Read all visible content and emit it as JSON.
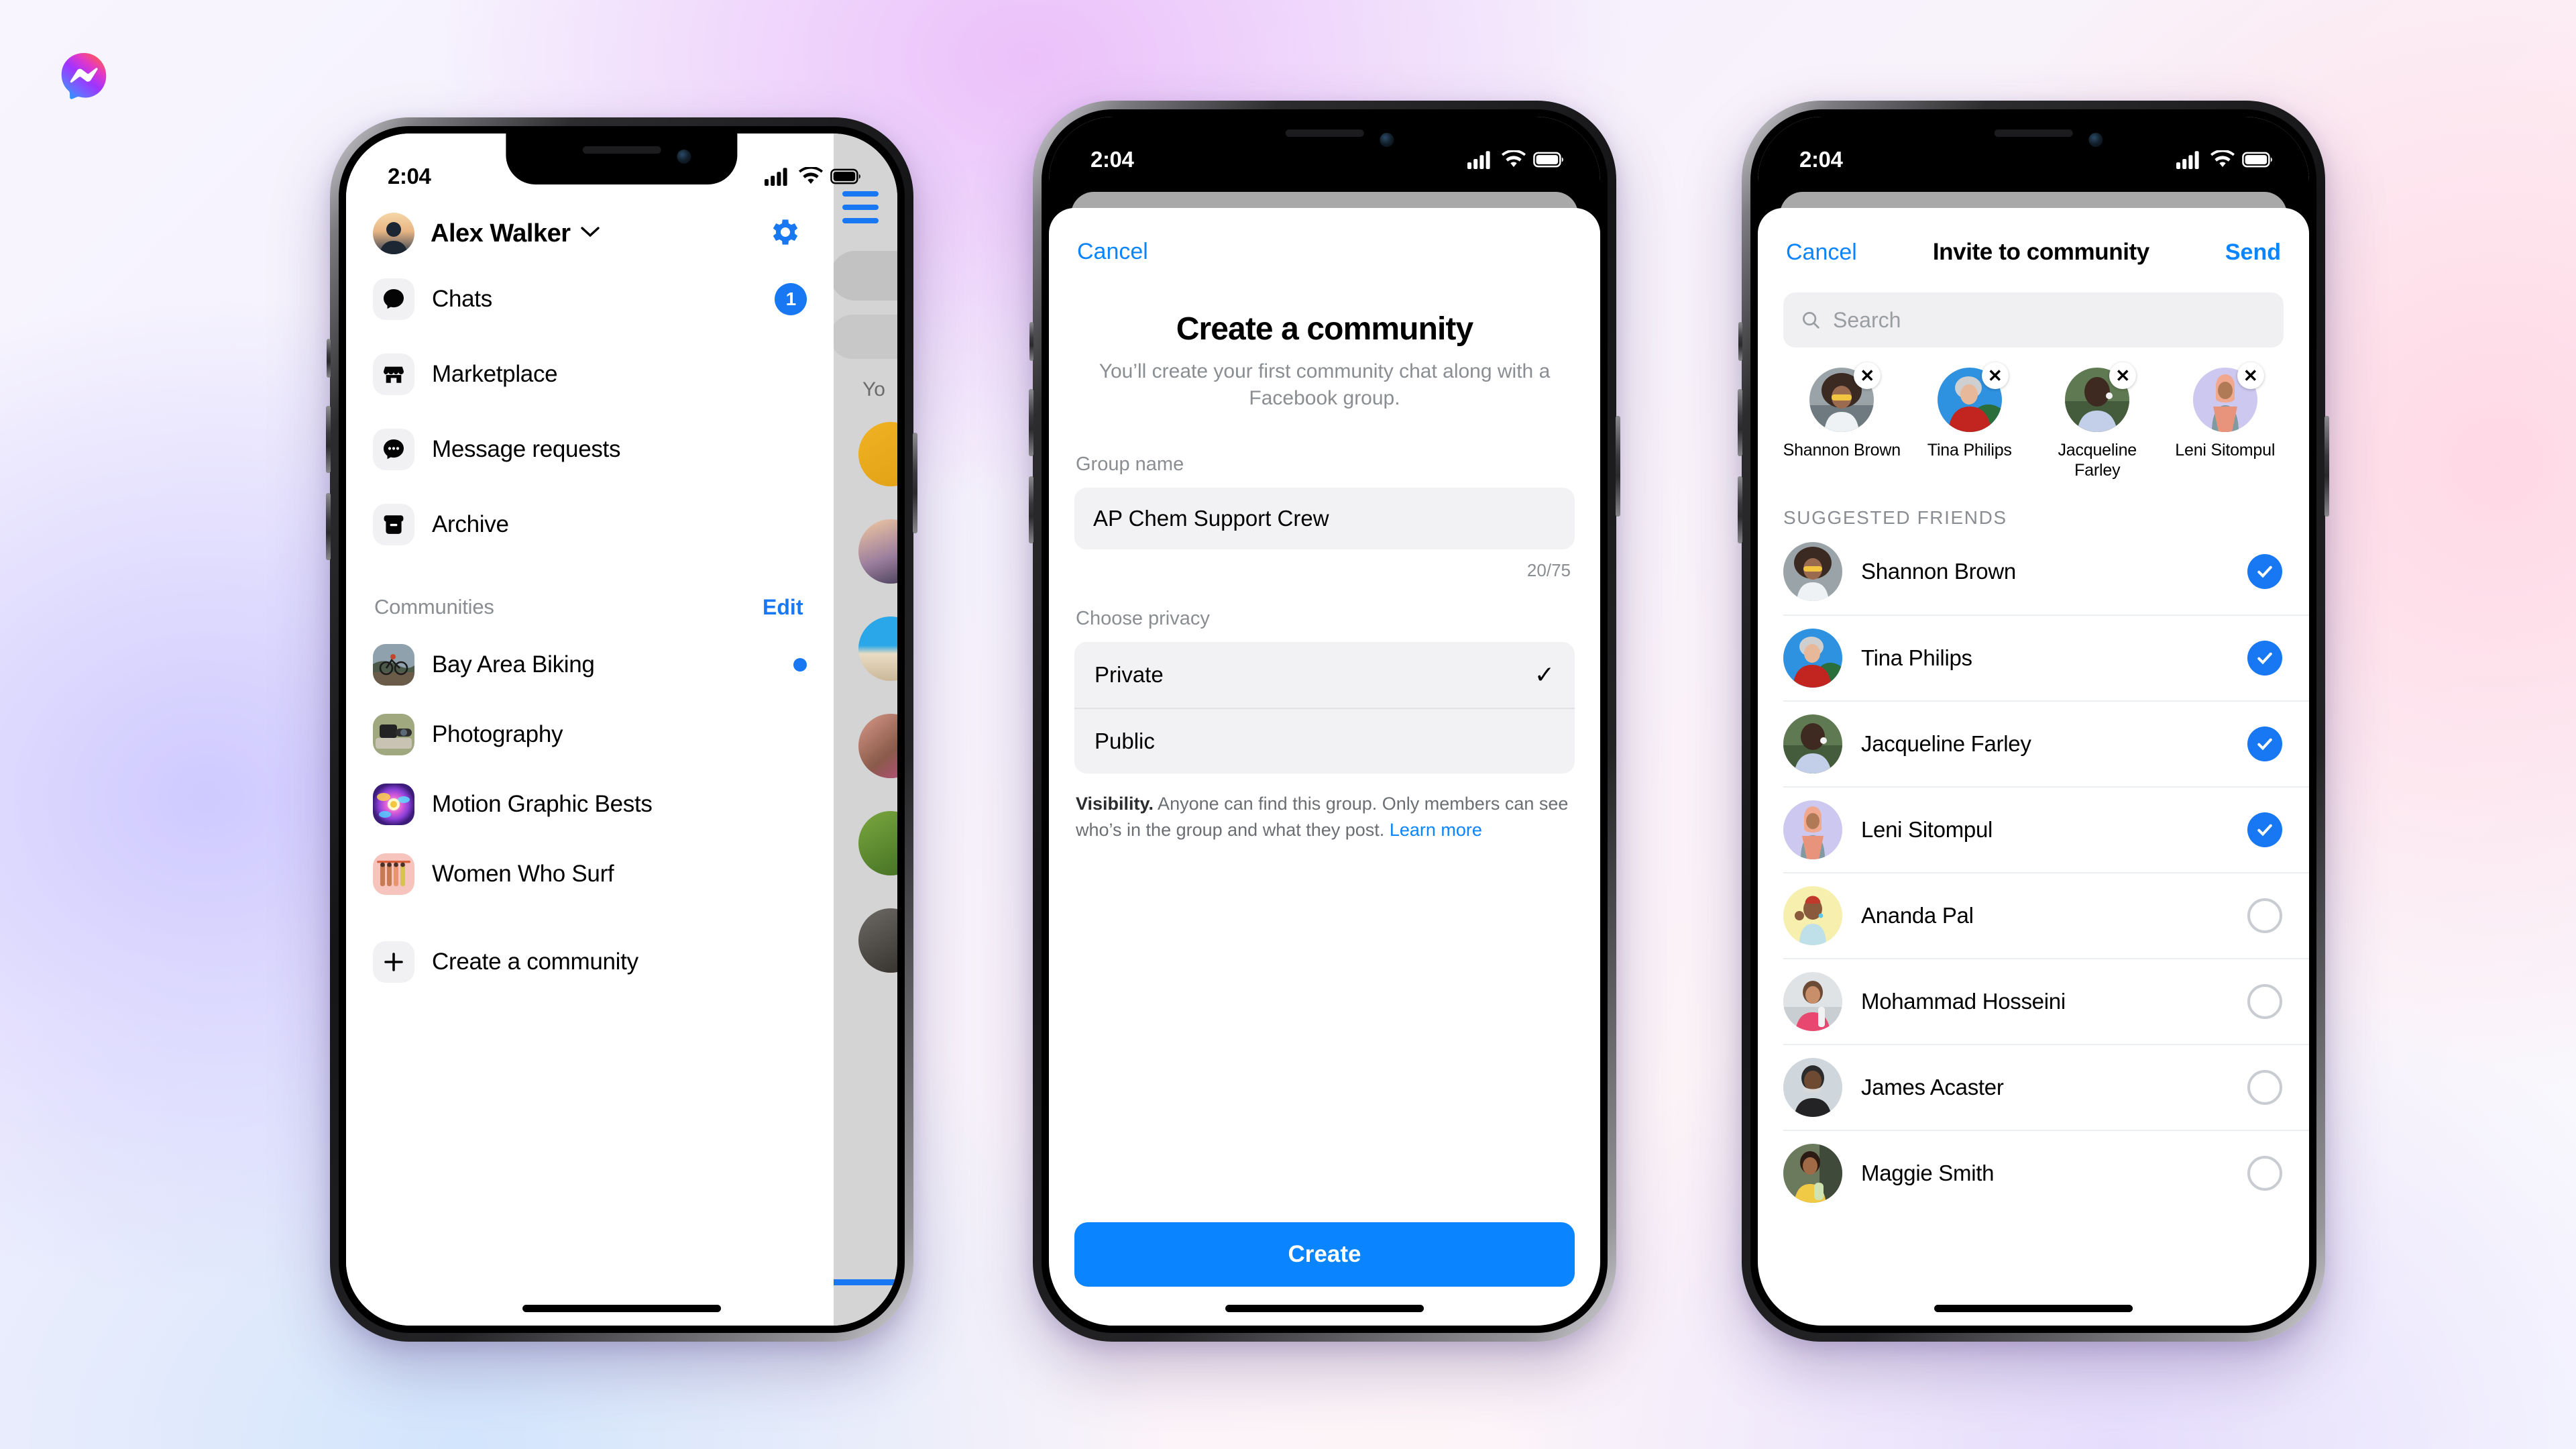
{
  "brand": {
    "logo_name": "messenger-logo",
    "accent": "#1877f2",
    "ios_blue": "#0a84ff"
  },
  "phone1": {
    "status": {
      "time": "2:04",
      "signal": "cellular-bars",
      "wifi": "wifi",
      "battery": "battery-full"
    },
    "drawer": {
      "profile_name": "Alex Walker",
      "chevron": "⌄",
      "gear_icon": "gear-icon",
      "items": [
        {
          "label": "Chats",
          "icon": "chat-bubble-icon",
          "badge": "1"
        },
        {
          "label": "Marketplace",
          "icon": "storefront-icon",
          "badge": ""
        },
        {
          "label": "Message requests",
          "icon": "message-requests-icon",
          "badge": ""
        },
        {
          "label": "Archive",
          "icon": "archive-box-icon",
          "badge": ""
        }
      ],
      "section_title": "Communities",
      "section_action": "Edit",
      "communities": [
        {
          "label": "Bay Area Biking",
          "unread": true
        },
        {
          "label": "Photography",
          "unread": false
        },
        {
          "label": "Motion Graphic Bests",
          "unread": false
        },
        {
          "label": "Women Who Surf",
          "unread": false
        }
      ],
      "create_label": "Create a community",
      "create_icon": "plus-icon"
    },
    "behind": {
      "peek_label": "Yo",
      "hamburger": "hamburger-icon"
    }
  },
  "phone2": {
    "status": {
      "time": "2:04"
    },
    "sheet": {
      "cancel": "Cancel",
      "heading": "Create a community",
      "subheading": "You’ll create your first community chat along with a Facebook group.",
      "group_name_label": "Group name",
      "group_name_value": "AP Chem Support Crew",
      "char_count": "20/75",
      "privacy_label": "Choose privacy",
      "privacy_options": [
        {
          "label": "Private",
          "selected": true,
          "check": "✓"
        },
        {
          "label": "Public",
          "selected": false,
          "check": ""
        }
      ],
      "visibility_bold": "Visibility.",
      "visibility_text": " Anyone can find this group. Only members can see who’s in the group and what they post. ",
      "visibility_link": "Learn more",
      "create_button": "Create"
    }
  },
  "phone3": {
    "status": {
      "time": "2:04"
    },
    "sheet": {
      "cancel": "Cancel",
      "title": "Invite to community",
      "send": "Send",
      "search_placeholder": "Search",
      "search_icon": "search-icon",
      "selected": [
        {
          "name": "Shannon Brown",
          "remove_icon": "close-icon"
        },
        {
          "name": "Tina Philips",
          "remove_icon": "close-icon"
        },
        {
          "name": "Jacqueline Farley",
          "remove_icon": "close-icon"
        },
        {
          "name": "Leni Sitompul",
          "remove_icon": "close-icon"
        }
      ],
      "section_header": "SUGGESTED FRIENDS",
      "friends": [
        {
          "name": "Shannon Brown",
          "selected": true
        },
        {
          "name": "Tina Philips",
          "selected": true
        },
        {
          "name": "Jacqueline Farley",
          "selected": true
        },
        {
          "name": "Leni Sitompul",
          "selected": true
        },
        {
          "name": "Ananda Pal",
          "selected": false
        },
        {
          "name": "Mohammad Hosseini",
          "selected": false
        },
        {
          "name": "James Acaster",
          "selected": false
        },
        {
          "name": "Maggie Smith",
          "selected": false
        }
      ]
    }
  }
}
